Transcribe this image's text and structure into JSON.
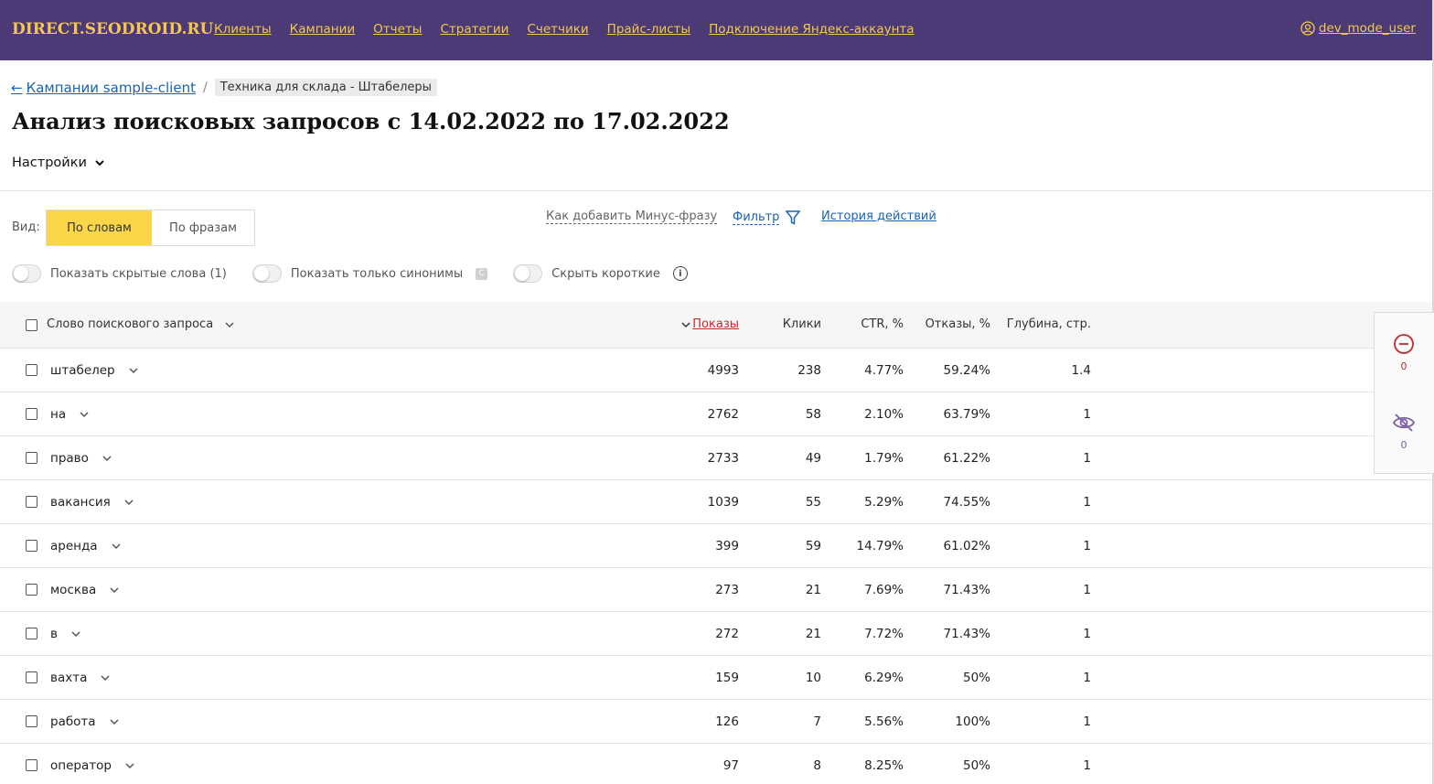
{
  "header": {
    "logo": "DIRECT.SEODROID.RU",
    "nav": [
      "Клиенты",
      "Кампании",
      "Отчеты",
      "Стратегии",
      "Счетчики",
      "Прайс-листы",
      "Подключение Яндекс-аккаунта"
    ],
    "user": "dev_mode_user"
  },
  "breadcrumb": {
    "back": "Кампании sample-client",
    "separator": "/",
    "current": "Техника для склада - Штабелеры"
  },
  "page_title": "Анализ поисковых запросов с 14.02.2022 по 17.02.2022",
  "settings_label": "Настройки",
  "view": {
    "label": "Вид:",
    "by_words": "По словам",
    "by_phrases": "По фразам"
  },
  "links": {
    "how_add_minus": "Как добавить Минус-фразу",
    "filter": "Фильтр",
    "history": "История действий"
  },
  "toggles": {
    "show_hidden": "Показать скрытые слова (1)",
    "only_synonyms": "Показать только синонимы",
    "synonym_badge": "C",
    "hide_short": "Скрыть короткие",
    "info": "i"
  },
  "table": {
    "headers": {
      "word": "Слово поискового запроса",
      "shows": "Показы",
      "clicks": "Клики",
      "ctr": "CTR, %",
      "bounces": "Отказы, %",
      "depth": "Глубина, стр."
    },
    "rows": [
      {
        "word": "штабелер",
        "shows": "4993",
        "clicks": "238",
        "ctr": "4.77%",
        "bounces": "59.24%",
        "depth": "1.4"
      },
      {
        "word": "на",
        "shows": "2762",
        "clicks": "58",
        "ctr": "2.10%",
        "bounces": "63.79%",
        "depth": "1"
      },
      {
        "word": "право",
        "shows": "2733",
        "clicks": "49",
        "ctr": "1.79%",
        "bounces": "61.22%",
        "depth": "1"
      },
      {
        "word": "вакансия",
        "shows": "1039",
        "clicks": "55",
        "ctr": "5.29%",
        "bounces": "74.55%",
        "depth": "1"
      },
      {
        "word": "аренда",
        "shows": "399",
        "clicks": "59",
        "ctr": "14.79%",
        "bounces": "61.02%",
        "depth": "1"
      },
      {
        "word": "москва",
        "shows": "273",
        "clicks": "21",
        "ctr": "7.69%",
        "bounces": "71.43%",
        "depth": "1"
      },
      {
        "word": "в",
        "shows": "272",
        "clicks": "21",
        "ctr": "7.72%",
        "bounces": "71.43%",
        "depth": "1"
      },
      {
        "word": "вахта",
        "shows": "159",
        "clicks": "10",
        "ctr": "6.29%",
        "bounces": "50%",
        "depth": "1"
      },
      {
        "word": "работа",
        "shows": "126",
        "clicks": "7",
        "ctr": "5.56%",
        "bounces": "100%",
        "depth": "1"
      },
      {
        "word": "оператор",
        "shows": "97",
        "clicks": "8",
        "ctr": "8.25%",
        "bounces": "50%",
        "depth": "1"
      }
    ]
  },
  "side_panel": {
    "minus_count": "0",
    "hidden_count": "0"
  },
  "colors": {
    "header_bg": "#4b3a75",
    "header_text": "#f5c84c",
    "accent_yellow": "#fbd648",
    "link_blue": "#1b62b0",
    "sorted_red": "#c42b2b"
  }
}
